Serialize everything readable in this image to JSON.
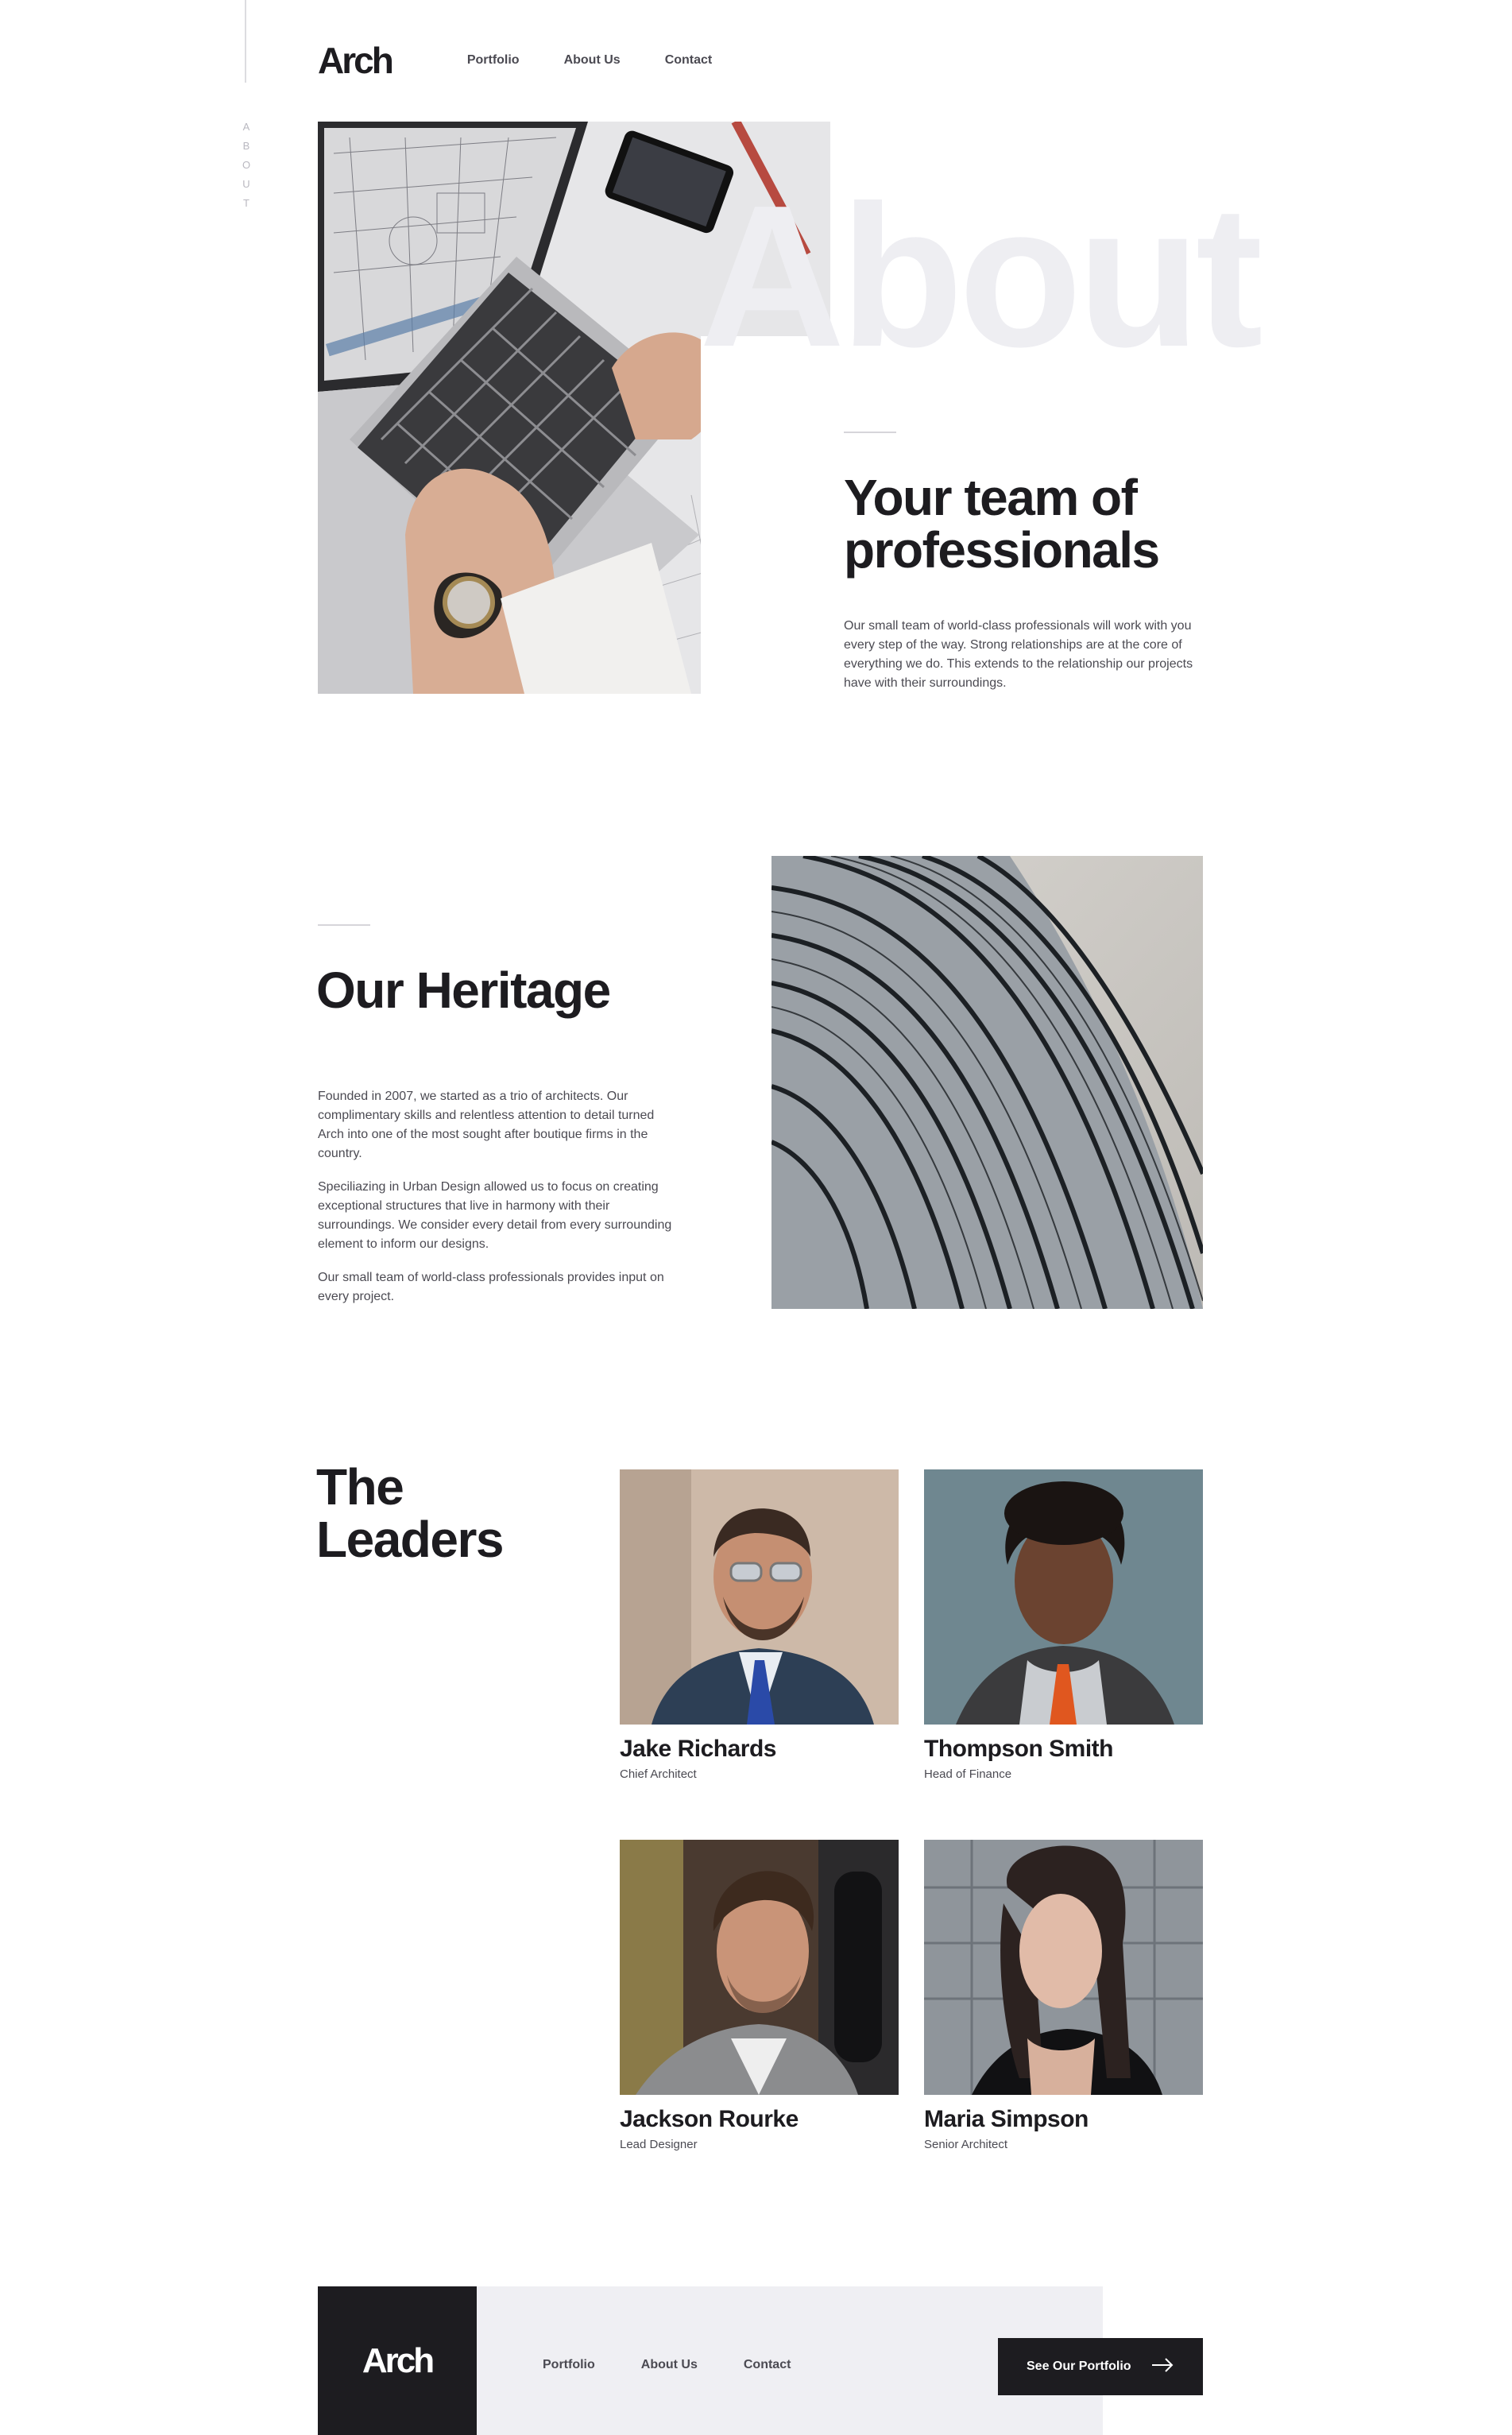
{
  "side": {
    "label": "ABOUT"
  },
  "header": {
    "logo": "Arch",
    "nav": [
      "Portfolio",
      "About Us",
      "Contact"
    ]
  },
  "hero": {
    "watermark": "About",
    "title": "Your team of professionals",
    "text": "Our small team of world-class professionals will work with you every step of the way. Strong relationships are at the core of everything we do. This extends to the relationship our projects have with their surroundings."
  },
  "heritage": {
    "title": "Our Heritage",
    "paragraphs": [
      "Founded in 2007, we started as a trio of architects. Our complimentary skills and relentless attention to detail turned Arch into one of the most sought after boutique firms in the country.",
      "Speciliazing in Urban Design allowed us to focus on creating exceptional structures that live in harmony with their surroundings. We consider every detail from every surrounding element to inform our designs.",
      "Our small team of world-class professionals provides input on every project."
    ]
  },
  "leaders": {
    "title": "The Leaders",
    "people": [
      {
        "name": "Jake Richards",
        "role": "Chief Architect"
      },
      {
        "name": "Thompson Smith",
        "role": "Head of Finance"
      },
      {
        "name": "Jackson Rourke",
        "role": "Lead Designer"
      },
      {
        "name": "Maria Simpson",
        "role": "Senior Architect"
      }
    ]
  },
  "footer": {
    "logo": "Arch",
    "nav": [
      "Portfolio",
      "About Us",
      "Contact"
    ],
    "cta_label": "See Our Portfolio",
    "cta_icon": "arrow-right-icon"
  },
  "colors": {
    "ink": "#1d1c20",
    "body_text": "#4b4a52",
    "light_bg": "#efeff3",
    "watermark": "#eeeef2"
  }
}
